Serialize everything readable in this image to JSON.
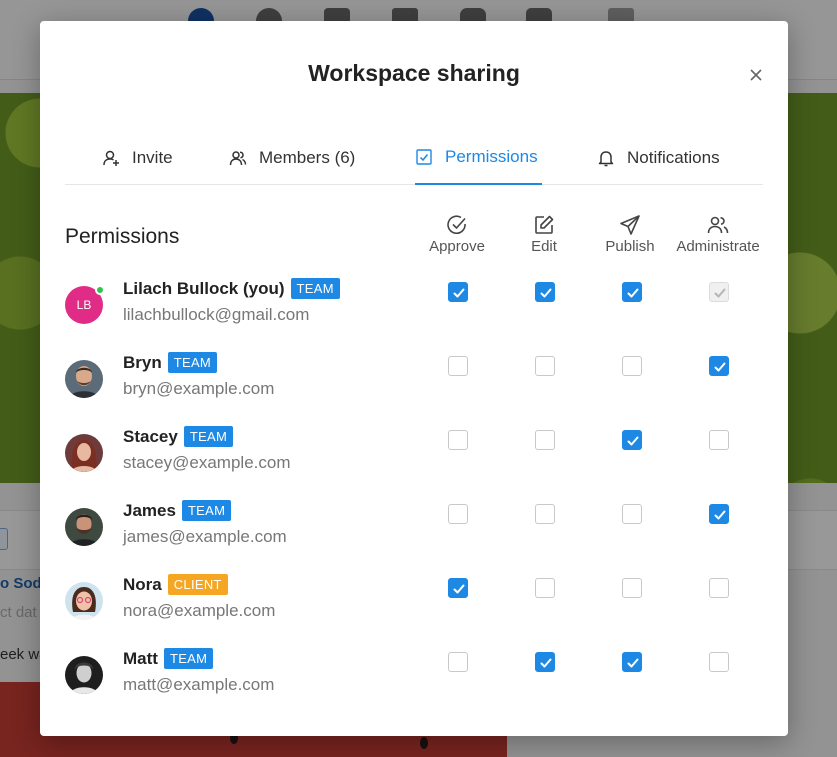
{
  "background": {
    "link_text": "o Sod",
    "muted_text": "ct dat",
    "week_text": "eek wa"
  },
  "modal": {
    "title": "Workspace sharing"
  },
  "tabs": [
    {
      "label": "Invite",
      "icon": "user-plus-icon",
      "active": false
    },
    {
      "label": "Members (6)",
      "icon": "users-icon",
      "active": false
    },
    {
      "label": "Permissions",
      "icon": "checkbox-icon",
      "active": true
    },
    {
      "label": "Notifications",
      "icon": "bell-icon",
      "active": false
    }
  ],
  "permissions": {
    "title": "Permissions",
    "columns": [
      {
        "label": "Approve",
        "icon": "check-circle-icon"
      },
      {
        "label": "Edit",
        "icon": "edit-icon"
      },
      {
        "label": "Publish",
        "icon": "send-icon"
      },
      {
        "label": "Administrate",
        "icon": "users-icon"
      }
    ],
    "members": [
      {
        "name": "Lilach Bullock (you)",
        "role": "TEAM",
        "email": "lilachbullock@gmail.com",
        "avatar": "LB",
        "online": true,
        "perms": [
          "on",
          "on",
          "on",
          "disabled"
        ]
      },
      {
        "name": "Bryn",
        "role": "TEAM",
        "email": "bryn@example.com",
        "avatar": "photo",
        "perms": [
          "off",
          "off",
          "off",
          "on"
        ]
      },
      {
        "name": "Stacey",
        "role": "TEAM",
        "email": "stacey@example.com",
        "avatar": "photo",
        "perms": [
          "off",
          "off",
          "on",
          "off"
        ]
      },
      {
        "name": "James",
        "role": "TEAM",
        "email": "james@example.com",
        "avatar": "photo",
        "perms": [
          "off",
          "off",
          "off",
          "on"
        ]
      },
      {
        "name": "Nora",
        "role": "CLIENT",
        "email": "nora@example.com",
        "avatar": "photo",
        "perms": [
          "on",
          "off",
          "off",
          "off"
        ]
      },
      {
        "name": "Matt",
        "role": "TEAM",
        "email": "matt@example.com",
        "avatar": "photo",
        "perms": [
          "off",
          "on",
          "on",
          "off"
        ]
      }
    ]
  },
  "colors": {
    "accent": "#1e88e5",
    "team_badge": "#1e88e5",
    "client_badge": "#f5a623",
    "avatar_initials_bg": "#e02c86",
    "online": "#30c44c"
  }
}
